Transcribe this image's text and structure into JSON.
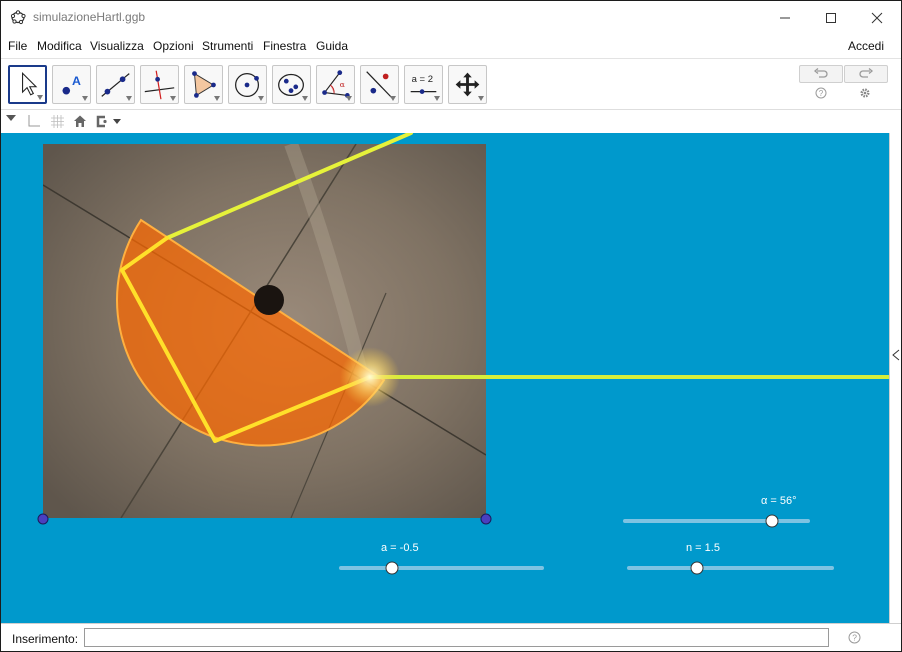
{
  "window": {
    "title": "simulazioneHartl.ggb"
  },
  "menubar": {
    "items": [
      "File",
      "Modifica",
      "Visualizza",
      "Opzioni",
      "Strumenti",
      "Finestra",
      "Guida"
    ],
    "signin_label": "Accedi"
  },
  "toolbar": {
    "tools": [
      "move",
      "point",
      "line",
      "perpendicular-line",
      "polygon",
      "circle",
      "ellipse",
      "angle",
      "reflect",
      "slider",
      "move-graphics-view"
    ],
    "slider_tool_label": "a = 2",
    "angle_tool_label": "α"
  },
  "sliders": {
    "alpha": {
      "label": "α = 56°",
      "value_deg": 56
    },
    "a": {
      "label": "a = -0.5",
      "value": -0.5
    },
    "n": {
      "label": "n = 1.5",
      "value": 1.5
    }
  },
  "input_bar": {
    "label": "Inserimento:",
    "value": "",
    "placeholder": ""
  },
  "colors": {
    "graphics_background": "#0099cc",
    "ray": "#e6f23a",
    "semicircle": "#ff6a00",
    "point": "#4a3fbf"
  }
}
